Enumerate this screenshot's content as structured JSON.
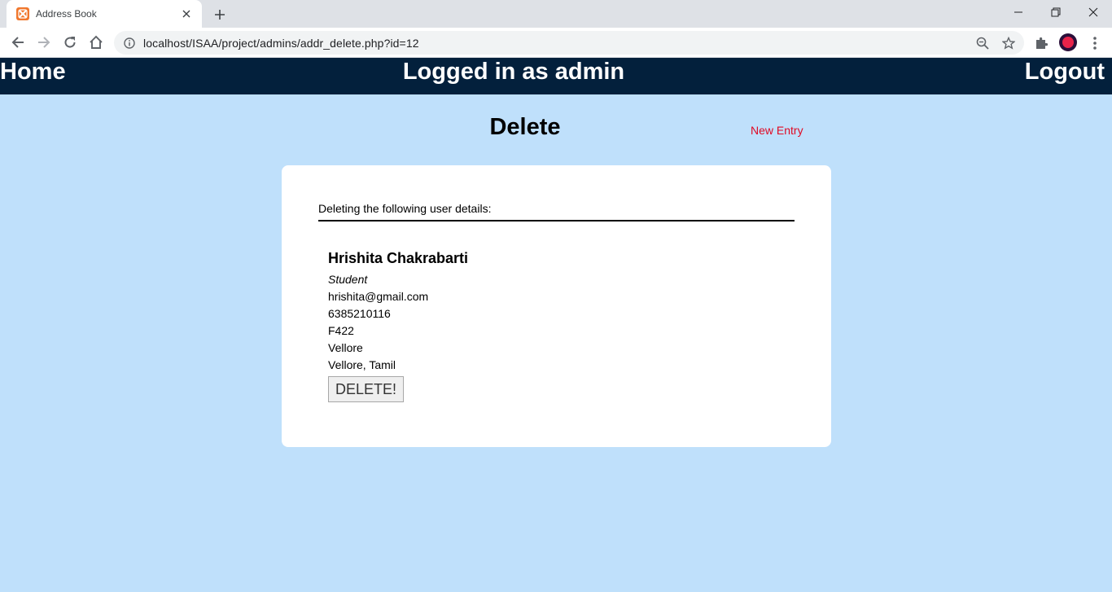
{
  "browser": {
    "tab_title": "Address Book",
    "url": "localhost/ISAA/project/admins/addr_delete.php?id=12",
    "favicon_color": "#f0772d"
  },
  "topnav": {
    "home": "Home",
    "status": "Logged in as admin",
    "logout": "Logout"
  },
  "page": {
    "heading": "Delete",
    "new_entry": "New Entry"
  },
  "card": {
    "intro": "Deleting the following user details:",
    "entry": {
      "name": "Hrishita Chakrabarti",
      "role": "Student",
      "email": "hrishita@gmail.com",
      "phone": "6385210116",
      "address_line1": "F422",
      "address_line2": "Vellore",
      "address_line3": "Vellore, Tamil"
    },
    "delete_button": "DELETE!"
  },
  "colors": {
    "page_bg": "#bfe0fb",
    "nav_bg": "#03203c",
    "link_red": "#e00a24"
  }
}
